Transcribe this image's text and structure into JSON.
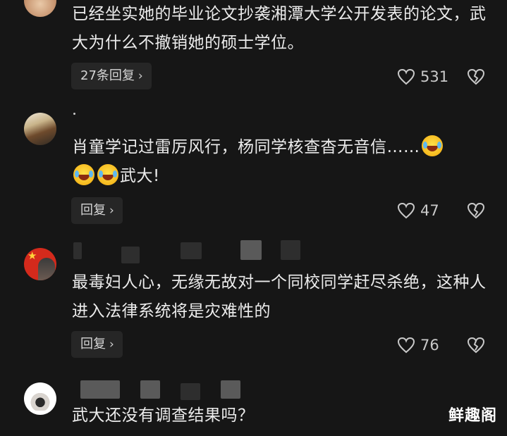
{
  "comments": [
    {
      "text": "已经坐实她的毕业论文抄袭湘潭大学公开发表的论文，武大为什么不撤销她的硕士学位。",
      "reply_label": "27条回复",
      "like_count": "531"
    },
    {
      "text": "肖童学记过雷厉风行，杨同学核查杳无音信……",
      "text_end": "武大!",
      "reply_label": "回复",
      "like_count": "47"
    },
    {
      "text": "最毒妇人心，无缘无故对一个同校同学赶尽杀绝，这种人进入法律系统将是灾难性的",
      "reply_label": "回复",
      "like_count": "76"
    },
    {
      "text": "武大还没有调查结果吗？"
    }
  ],
  "watermark": "鲜趣阁",
  "icons": {
    "like": "heart-outline-icon",
    "dislike": "broken-heart-icon",
    "reply_chevron": "chevron-right-icon",
    "emoji": "tears-of-joy-emoji"
  },
  "colors": {
    "background": "#161616",
    "text": "#ececec",
    "button_bg": "#262626",
    "secondary": "#c9c9c9"
  }
}
